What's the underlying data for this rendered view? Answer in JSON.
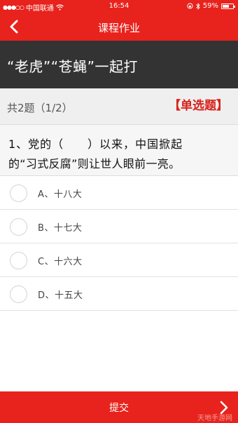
{
  "status_bar": {
    "carrier": "中国联通",
    "time": "16:54",
    "battery": "59%"
  },
  "nav": {
    "title": "课程作业"
  },
  "course": {
    "title": "“老虎”“苍蝇”一起打"
  },
  "progress": {
    "text": "共2题（1/2）",
    "question_type": "【单选题】"
  },
  "question": {
    "line1": "1、党的（　　）以来，中国掀起",
    "line2": "的“习式反腐”则让世人眼前一亮。"
  },
  "options": [
    {
      "label": "A、十八大"
    },
    {
      "label": "B、十七大"
    },
    {
      "label": "C、十六大"
    },
    {
      "label": "D、十五大"
    }
  ],
  "submit": {
    "label": "提交"
  },
  "watermark": "天地手游网",
  "colors": {
    "accent": "#e8221c",
    "banner": "#333333",
    "tag": "#d8211a"
  }
}
